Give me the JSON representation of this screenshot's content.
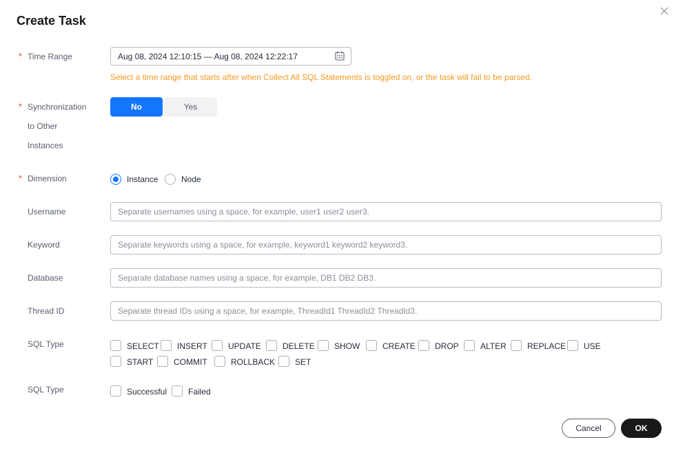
{
  "dialog": {
    "title": "Create Task"
  },
  "form": {
    "time_range": {
      "label": "Time Range",
      "value": "Aug 08, 2024 12:10:15 — Aug 08, 2024 12:22:17",
      "hint": "Select a time range that starts after when Collect All SQL Statements is toggled on, or the task will fail to be parsed."
    },
    "sync": {
      "label_line1": "Synchronization",
      "label_line2": "to Other",
      "label_line3": "Instances",
      "options": [
        "No",
        "Yes"
      ],
      "selected": "No"
    },
    "dimension": {
      "label": "Dimension",
      "options": [
        "Instance",
        "Node"
      ],
      "selected": "Instance"
    },
    "username": {
      "label": "Username",
      "placeholder": "Separate usernames using a space, for example, user1 user2 user3."
    },
    "keyword": {
      "label": "Keyword",
      "placeholder": "Separate keywords using a space, for example, keyword1 keyword2 keyword3."
    },
    "database": {
      "label": "Database",
      "placeholder": "Separate database names using a space, for example, DB1 DB2 DB3."
    },
    "thread_id": {
      "label": "Thread ID",
      "placeholder": "Separate thread IDs using a space, for example, ThreadId1 ThreadId2 ThreadId3."
    },
    "sql_type": {
      "label": "SQL Type",
      "options": [
        "SELECT",
        "INSERT",
        "UPDATE",
        "DELETE",
        "SHOW",
        "CREATE",
        "DROP",
        "ALTER",
        "REPLACE",
        "USE",
        "START",
        "COMMIT",
        "ROLLBACK",
        "SET"
      ]
    },
    "sql_result": {
      "label": "SQL Type",
      "options": [
        "Successful",
        "Failed"
      ]
    }
  },
  "footer": {
    "cancel_label": "Cancel",
    "ok_label": "OK"
  },
  "colors": {
    "primary": "#1476ff",
    "required": "#e84242",
    "hint": "#f59a23",
    "ok_button": "#191919"
  }
}
